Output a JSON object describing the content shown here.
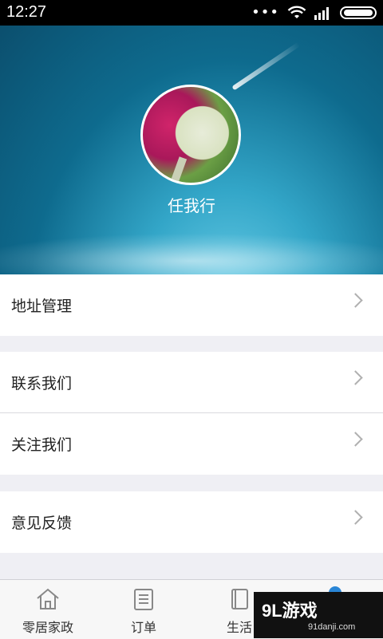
{
  "status_bar": {
    "time": "12:27",
    "dots": "•••"
  },
  "profile": {
    "username": "任我行"
  },
  "menu_groups": [
    {
      "items": [
        {
          "label": "地址管理"
        }
      ]
    },
    {
      "items": [
        {
          "label": "联系我们"
        },
        {
          "label": "关注我们"
        }
      ]
    },
    {
      "items": [
        {
          "label": "意见反馈"
        }
      ]
    }
  ],
  "tabbar": {
    "tabs": [
      {
        "label": "零居家政",
        "icon": "home-icon"
      },
      {
        "label": "订单",
        "icon": "order-icon"
      },
      {
        "label": "生活",
        "icon": "book-icon"
      }
    ],
    "active_color": "#2a86d6"
  },
  "watermark": {
    "main": "9L游戏",
    "sub": "91danji.com"
  }
}
